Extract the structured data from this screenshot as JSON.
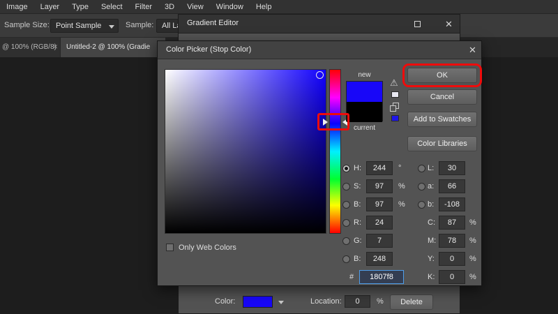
{
  "menu_bar": {
    "items": [
      "Image",
      "Layer",
      "Type",
      "Select",
      "Filter",
      "3D",
      "View",
      "Window",
      "Help"
    ]
  },
  "options_bar": {
    "sample_size_label": "Sample Size:",
    "sample_size_value": "Point Sample",
    "sample_label": "Sample:",
    "sample_value": "All Layers"
  },
  "tab_bar": {
    "tab1_label": "@ 100% (RGB/8)",
    "tab2_label": "Untitled-2 @ 100% (Gradie"
  },
  "gradient_editor": {
    "title": "Gradient Editor",
    "footer": {
      "color_label": "Color:",
      "location_label": "Location:",
      "location_value": "0",
      "location_unit": "%",
      "delete_label": "Delete"
    }
  },
  "color_picker": {
    "title": "Color Picker (Stop Color)",
    "new_label": "new",
    "current_label": "current",
    "only_web_colors_label": "Only Web Colors",
    "hex_prefix": "#",
    "hex_value": "1807f8",
    "buttons": {
      "ok": "OK",
      "cancel": "Cancel",
      "add_to_swatches": "Add to Swatches",
      "color_libraries": "Color Libraries"
    },
    "left_rows": [
      {
        "label": "H:",
        "value": "244",
        "unit": "°"
      },
      {
        "label": "S:",
        "value": "97",
        "unit": "%"
      },
      {
        "label": "B:",
        "value": "97",
        "unit": "%"
      },
      {
        "label": "R:",
        "value": "24",
        "unit": ""
      },
      {
        "label": "G:",
        "value": "7",
        "unit": ""
      },
      {
        "label": "B:",
        "value": "248",
        "unit": ""
      }
    ],
    "right_rows": [
      {
        "label": "L:",
        "value": "30",
        "unit": ""
      },
      {
        "label": "a:",
        "value": "66",
        "unit": ""
      },
      {
        "label": "b:",
        "value": "-108",
        "unit": ""
      },
      {
        "label": "C:",
        "value": "87",
        "unit": "%"
      },
      {
        "label": "M:",
        "value": "78",
        "unit": "%"
      },
      {
        "label": "Y:",
        "value": "0",
        "unit": "%"
      },
      {
        "label": "K:",
        "value": "0",
        "unit": "%"
      }
    ],
    "colors": {
      "new": "#1807f8",
      "current": "#000000",
      "hue_degrees": "244",
      "annotation_red": "#ef0b0b"
    }
  },
  "icons": {
    "close": "✕",
    "warning": "⚠"
  }
}
